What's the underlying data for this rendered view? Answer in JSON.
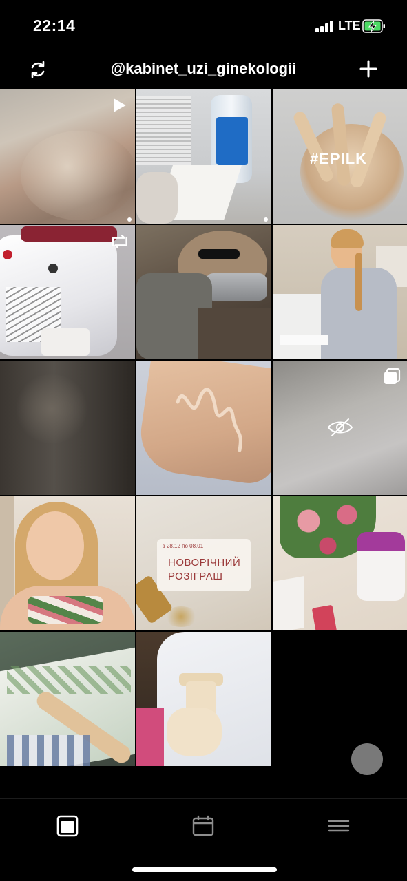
{
  "status_bar": {
    "time": "22:14",
    "network": "LTE",
    "battery_charging": true
  },
  "header": {
    "username": "@kabinet_uzi_ginekologii"
  },
  "grid": {
    "posts": [
      {
        "name": "post-gel-skin-reel",
        "overlay": "play-icon",
        "dot": true
      },
      {
        "name": "post-spray-bottle",
        "overlay": "",
        "dot": true
      },
      {
        "name": "post-epilk-wax-sticks",
        "overlay": "",
        "dot": false,
        "text": "#EPILK"
      },
      {
        "name": "post-laser-device",
        "overlay": "reel-icon",
        "dot": false
      },
      {
        "name": "post-laser-procedure",
        "overlay": "",
        "dot": false
      },
      {
        "name": "post-doctor-portrait",
        "overlay": "",
        "dot": false
      },
      {
        "name": "post-blurred-dark",
        "overlay": "",
        "dot": false
      },
      {
        "name": "post-gel-on-arm",
        "overlay": "",
        "dot": false
      },
      {
        "name": "post-hidden-skin",
        "overlay": "carousel-icon",
        "dot": false,
        "center": "eye-slash-icon"
      },
      {
        "name": "post-woman-flowers",
        "overlay": "",
        "dot": false
      },
      {
        "name": "post-new-year-giveaway",
        "overlay": "",
        "dot": false,
        "small_text": "з 28.12 по 08.01",
        "line1": "НОВОРІЧНИЙ",
        "line2": "РОЗІГРАШ"
      },
      {
        "name": "post-roses-device",
        "overlay": "",
        "dot": false
      },
      {
        "name": "post-wax-sticks-packages",
        "overlay": "",
        "dot": false
      },
      {
        "name": "post-ultrasound-probe",
        "overlay": "",
        "dot": false
      }
    ]
  },
  "bottom_nav": {
    "items": [
      "grid-view-icon",
      "calendar-icon",
      "menu-icon"
    ],
    "active": 0
  },
  "colors": {
    "background": "#000000",
    "accent_battery": "#4cd964",
    "giveaway_text": "#9b3a3a"
  }
}
